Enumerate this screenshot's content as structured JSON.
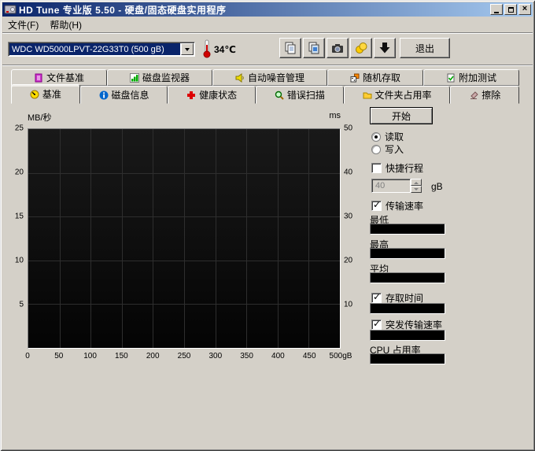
{
  "window": {
    "title": "HD Tune 专业版 5.50 - 硬盘/固态硬盘实用程序"
  },
  "menu": {
    "items": [
      {
        "label": "文件(F)"
      },
      {
        "label": "帮助(H)"
      }
    ]
  },
  "toolbar": {
    "drive_select": {
      "value": "WDC WD5000LPVT-22G33T0 (500 gB)"
    },
    "temperature": "34℃",
    "buttons": [
      {
        "icon": "copy-text-icon"
      },
      {
        "icon": "copy-image-icon"
      },
      {
        "icon": "camera-icon"
      },
      {
        "icon": "export-icon"
      },
      {
        "icon": "download-icon"
      }
    ],
    "exit_label": "退出"
  },
  "tabs": {
    "row1": [
      {
        "label": "文件基准",
        "icon": "file-benchmark-icon",
        "active": false
      },
      {
        "label": "磁盘监视器",
        "icon": "disk-monitor-icon",
        "active": false
      },
      {
        "label": "自动噪音管理",
        "icon": "noise-management-icon",
        "active": false
      },
      {
        "label": "随机存取",
        "icon": "random-access-icon",
        "active": false
      },
      {
        "label": "附加测试",
        "icon": "extra-tests-icon",
        "active": false
      }
    ],
    "row2": [
      {
        "label": "基准",
        "icon": "benchmark-icon",
        "active": true
      },
      {
        "label": "磁盘信息",
        "icon": "disk-info-icon",
        "active": false
      },
      {
        "label": "健康状态",
        "icon": "health-icon",
        "active": false
      },
      {
        "label": "错误扫描",
        "icon": "error-scan-icon",
        "active": false
      },
      {
        "label": "文件夹占用率",
        "icon": "folder-usage-icon",
        "active": false
      },
      {
        "label": "擦除",
        "icon": "erase-icon",
        "active": false
      }
    ]
  },
  "chart_data": {
    "type": "line",
    "title": "",
    "ylabel_left": "MB/秒",
    "ylabel_right": "ms",
    "y_left_ticks": [
      "25",
      "20",
      "15",
      "10",
      "5"
    ],
    "y_right_ticks": [
      "50",
      "40",
      "30",
      "20",
      "10"
    ],
    "y_left_range": [
      0,
      25
    ],
    "y_right_range": [
      0,
      50
    ],
    "x_ticks": [
      "0",
      "50",
      "100",
      "150",
      "200",
      "250",
      "300",
      "350",
      "400",
      "450",
      "500gB"
    ],
    "grid": true,
    "series": []
  },
  "panel": {
    "start_button": "开始",
    "mode": {
      "read": {
        "label": "读取",
        "selected": true
      },
      "write": {
        "label": "写入",
        "selected": false
      }
    },
    "short_stroke": {
      "label": "快捷行程",
      "checked": false,
      "value": "40",
      "unit": "gB"
    },
    "transfer_rate": {
      "label": "传输速率",
      "checked": true,
      "min_label": "最低",
      "max_label": "最高",
      "avg_label": "平均",
      "min": "",
      "max": "",
      "avg": ""
    },
    "access_time": {
      "label": "存取时间",
      "checked": true,
      "value": ""
    },
    "burst_rate": {
      "label": "突发传输速率",
      "checked": true,
      "value": ""
    },
    "cpu_usage": {
      "label": "CPU 占用率",
      "value": ""
    }
  }
}
